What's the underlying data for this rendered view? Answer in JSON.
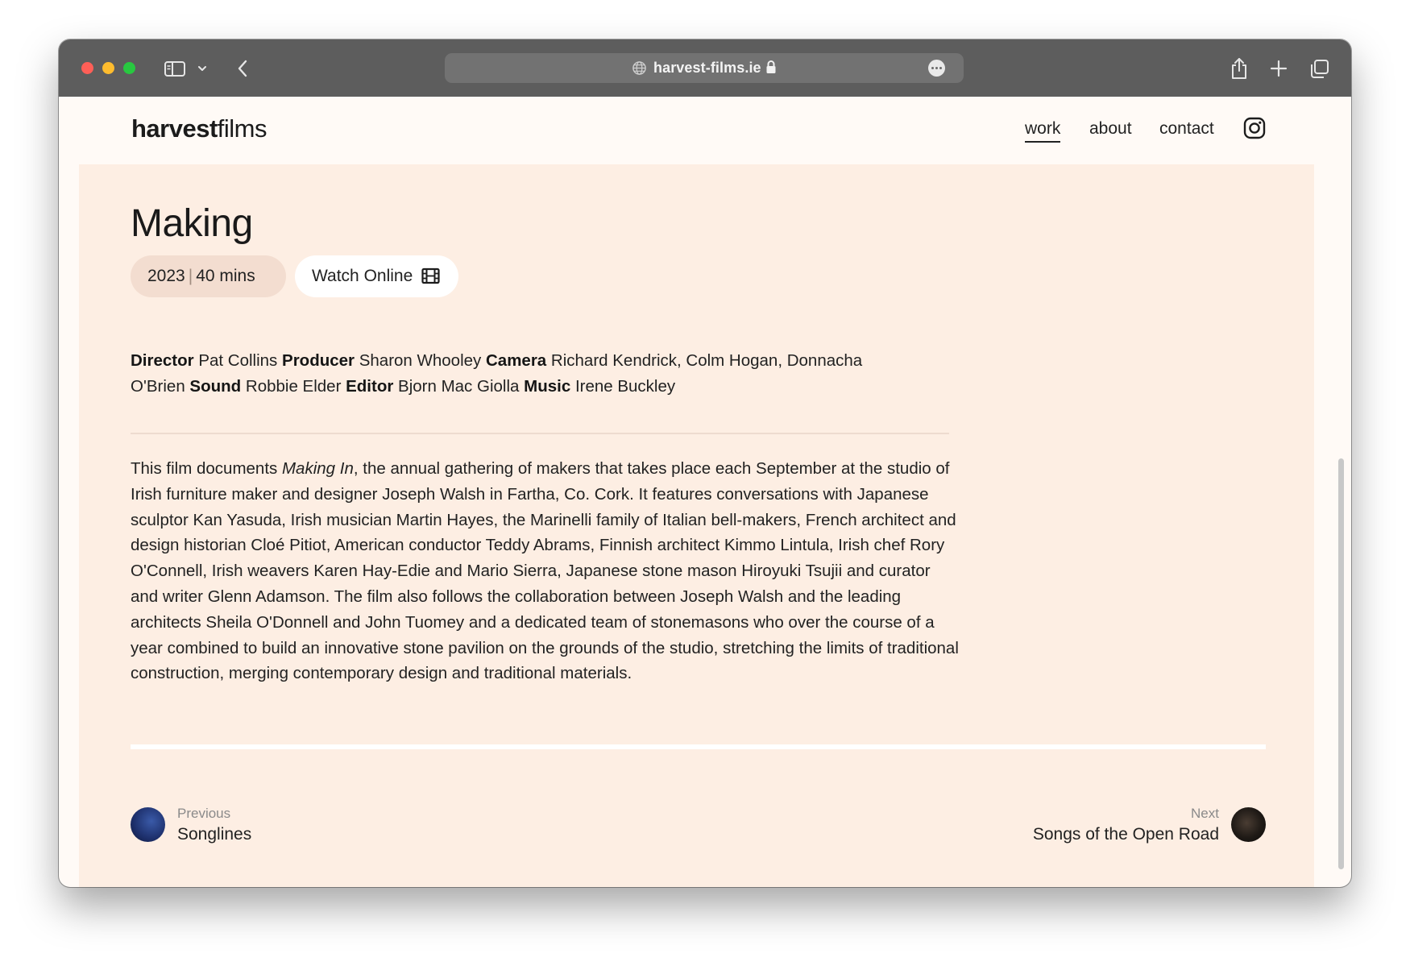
{
  "browser": {
    "url": "harvest-films.ie"
  },
  "site": {
    "logo_bold": "harvest",
    "logo_regular": "films",
    "nav": {
      "work": "work",
      "about": "about",
      "contact": "contact"
    }
  },
  "film": {
    "title": "Making",
    "year": "2023",
    "separator": "|",
    "duration": "40 mins",
    "watch_label": "Watch Online",
    "credits": [
      {
        "role": "Director",
        "names": "Pat Collins"
      },
      {
        "role": "Producer",
        "names": "Sharon Whooley"
      },
      {
        "role": "Camera",
        "names": "Richard Kendrick, Colm Hogan, Donnacha O'Brien"
      },
      {
        "role": "Sound",
        "names": "Robbie Elder"
      },
      {
        "role": "Editor",
        "names": "Bjorn Mac Giolla"
      },
      {
        "role": "Music",
        "names": "Irene Buckley"
      }
    ],
    "description_before": "This film documents ",
    "description_italic": "Making In",
    "description_after": ", the annual gathering of makers that takes place each September at the studio of Irish furniture maker and designer Joseph Walsh in Fartha, Co. Cork. It features conversations with Japanese sculptor Kan Yasuda, Irish musician Martin Hayes, the Marinelli family of Italian bell-makers, French architect and design historian Cloé Pitiot, American conductor Teddy Abrams, Finnish architect Kimmo Lintula,  Irish chef Rory O'Connell, Irish weavers Karen Hay-Edie and Mario Sierra, Japanese stone mason Hiroyuki Tsujii and curator and writer Glenn Adamson. The film also follows the collaboration between Joseph Walsh and the leading architects Sheila O'Donnell and John Tuomey and a dedicated team of stonemasons who over the course of a year combined to build an innovative stone pavilion on the grounds of the studio, stretching the limits of traditional construction, merging contemporary design and traditional materials."
  },
  "pager": {
    "prev_label": "Previous",
    "prev_title": "Songlines",
    "next_label": "Next",
    "next_title": "Songs of the Open Road"
  },
  "colors": {
    "page_bg": "#fdeee3",
    "header_bg": "#fffaf6",
    "meta_pill": "#f3ddd0",
    "titlebar": "#5d5d5d"
  }
}
